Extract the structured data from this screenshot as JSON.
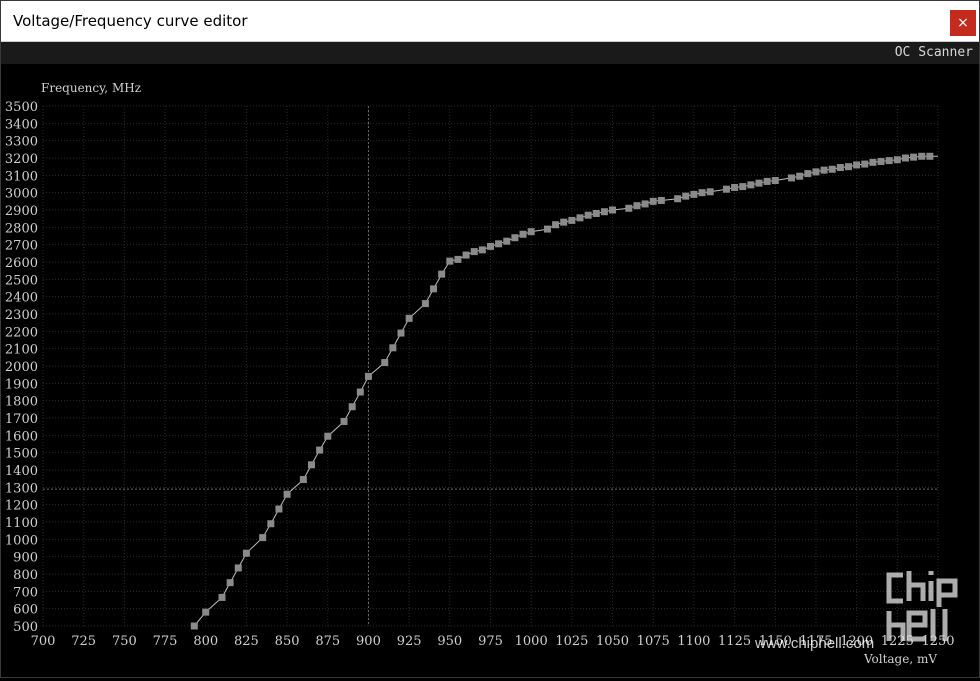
{
  "window": {
    "title": "Voltage/Frequency curve editor",
    "close_label": "×"
  },
  "toolbar": {
    "oc_scanner_label": "OC Scanner"
  },
  "watermark": {
    "url_text": "www.chiphell.com",
    "logo_text": "chip hell"
  },
  "colors": {
    "background": "#000000",
    "grid": "#2a2a2a",
    "curve": "#bdbdbd",
    "point": "#8a8a8a",
    "text": "#d0d0d0",
    "crosshair": "#6a6a6a"
  },
  "chart_data": {
    "type": "line",
    "xlabel": "Voltage, mV",
    "ylabel": "Frequency, MHz",
    "xlim": [
      700,
      1250
    ],
    "ylim": [
      500,
      3500
    ],
    "x_ticks": [
      700,
      725,
      750,
      775,
      800,
      825,
      850,
      875,
      900,
      925,
      950,
      975,
      1000,
      1025,
      1050,
      1075,
      1100,
      1125,
      1150,
      1175,
      1200,
      1225,
      1250
    ],
    "y_ticks": [
      500,
      600,
      700,
      800,
      900,
      1000,
      1100,
      1200,
      1300,
      1400,
      1500,
      1600,
      1700,
      1800,
      1900,
      2000,
      2100,
      2200,
      2300,
      2400,
      2500,
      2600,
      2700,
      2800,
      2900,
      3000,
      3100,
      3200,
      3300,
      3400,
      3500
    ],
    "grid": true,
    "crosshair": {
      "x": 900,
      "y": 1290
    },
    "series": [
      {
        "points": [
          [
            793,
            500
          ],
          [
            800,
            580
          ],
          [
            810,
            665
          ],
          [
            815,
            750
          ],
          [
            820,
            835
          ],
          [
            825,
            920
          ],
          [
            835,
            1010
          ],
          [
            840,
            1090
          ],
          [
            845,
            1175
          ],
          [
            850,
            1260
          ],
          [
            860,
            1345
          ],
          [
            865,
            1430
          ],
          [
            870,
            1515
          ],
          [
            875,
            1595
          ],
          [
            885,
            1680
          ],
          [
            890,
            1765
          ],
          [
            895,
            1850
          ],
          [
            900,
            1940
          ],
          [
            910,
            2020
          ],
          [
            915,
            2105
          ],
          [
            920,
            2190
          ],
          [
            925,
            2275
          ],
          [
            935,
            2360
          ],
          [
            940,
            2445
          ],
          [
            945,
            2530
          ],
          [
            950,
            2605
          ],
          [
            955,
            2615
          ],
          [
            960,
            2640
          ],
          [
            965,
            2660
          ],
          [
            970,
            2670
          ],
          [
            975,
            2690
          ],
          [
            980,
            2705
          ],
          [
            985,
            2720
          ],
          [
            990,
            2740
          ],
          [
            995,
            2760
          ],
          [
            1000,
            2775
          ],
          [
            1010,
            2790
          ],
          [
            1015,
            2815
          ],
          [
            1020,
            2830
          ],
          [
            1025,
            2840
          ],
          [
            1030,
            2855
          ],
          [
            1035,
            2870
          ],
          [
            1040,
            2880
          ],
          [
            1045,
            2890
          ],
          [
            1050,
            2900
          ],
          [
            1060,
            2910
          ],
          [
            1065,
            2925
          ],
          [
            1070,
            2935
          ],
          [
            1075,
            2950
          ],
          [
            1080,
            2955
          ],
          [
            1090,
            2965
          ],
          [
            1095,
            2980
          ],
          [
            1100,
            2990
          ],
          [
            1105,
            3000
          ],
          [
            1110,
            3005
          ],
          [
            1120,
            3020
          ],
          [
            1125,
            3030
          ],
          [
            1130,
            3035
          ],
          [
            1135,
            3045
          ],
          [
            1140,
            3055
          ],
          [
            1145,
            3065
          ],
          [
            1150,
            3070
          ],
          [
            1160,
            3085
          ],
          [
            1165,
            3095
          ],
          [
            1170,
            3110
          ],
          [
            1175,
            3120
          ],
          [
            1180,
            3130
          ],
          [
            1185,
            3135
          ],
          [
            1190,
            3145
          ],
          [
            1195,
            3150
          ],
          [
            1200,
            3160
          ],
          [
            1205,
            3165
          ],
          [
            1210,
            3175
          ],
          [
            1215,
            3180
          ],
          [
            1220,
            3185
          ],
          [
            1225,
            3190
          ],
          [
            1230,
            3200
          ],
          [
            1235,
            3205
          ],
          [
            1240,
            3210
          ],
          [
            1245,
            3210
          ],
          [
            1250,
            3210
          ]
        ]
      }
    ]
  }
}
